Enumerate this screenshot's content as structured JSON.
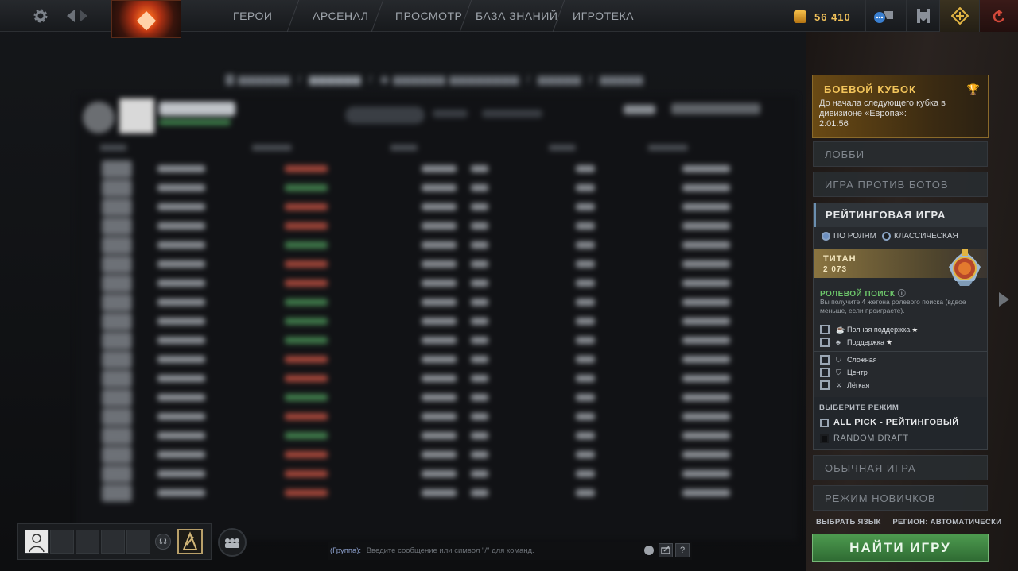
{
  "topnav": {
    "items": [
      {
        "label": "ГЕРОИ"
      },
      {
        "label": "АРСЕНАЛ"
      },
      {
        "label": "ПРОСМОТР"
      },
      {
        "label": "БАЗА ЗНАНИЙ"
      },
      {
        "label": "ИГРОТЕКА"
      }
    ],
    "gold": "56 410",
    "icons": [
      "gear-icon",
      "back-arrow-icon",
      "forward-arrow-icon",
      "dota-logo-icon",
      "chat-icon",
      "armory-icon",
      "plus-icon",
      "power-icon"
    ]
  },
  "battle_cup": {
    "title": "БОЕВОЙ КУБОК",
    "description": "До начала следующего кубка в дивизионе «Европа»:",
    "timer": "2:01:56"
  },
  "menu": {
    "lobby": "ЛОББИ",
    "bots": "ИГРА ПРОТИВ БОТОВ",
    "ranked": "РЕЙТИНГОВАЯ ИГРА",
    "normal": "ОБЫЧНАЯ ИГРА",
    "newbie": "РЕЖИМ НОВИЧКОВ"
  },
  "ranked": {
    "option_roles": "ПО РОЛЯМ",
    "option_classic": "КЛАССИЧЕСКАЯ",
    "selected_option": "ПО РОЛЯМ",
    "rank_name": "ТИТАН",
    "rank_value": "2 073",
    "role_search_title": "РОЛЕВОЙ ПОИСК",
    "role_search_desc": "Вы получите 4 жетона ролевого поиска (вдвое меньше, если проиграете).",
    "roles": [
      {
        "label": "Полная поддержка",
        "star": "★"
      },
      {
        "label": "Поддержка",
        "star": "★"
      },
      {
        "label": "Сложная",
        "star": ""
      },
      {
        "label": "Центр",
        "star": ""
      },
      {
        "label": "Лёгкая",
        "star": ""
      }
    ],
    "mode_title": "ВЫБЕРИТЕ РЕЖИМ",
    "modes": [
      {
        "label": "ALL PICK - РЕЙТИНГОВЫЙ",
        "checked": false
      },
      {
        "label": "RANDOM DRAFT",
        "checked": false
      }
    ]
  },
  "footer": {
    "language": "ВЫБРАТЬ ЯЗЫК",
    "region": "РЕГИОН: АВТОМАТИЧЕСКИ",
    "find_game": "НАЙТИ ИГРУ"
  },
  "chat": {
    "channel": "(Группа):",
    "placeholder": "Введите сообщение или символ \"/\" для команд.",
    "help": "?"
  },
  "colors": {
    "accent_gold": "#f1c35a",
    "find_green": "#3f8a42",
    "role_green": "#6cc46a"
  }
}
